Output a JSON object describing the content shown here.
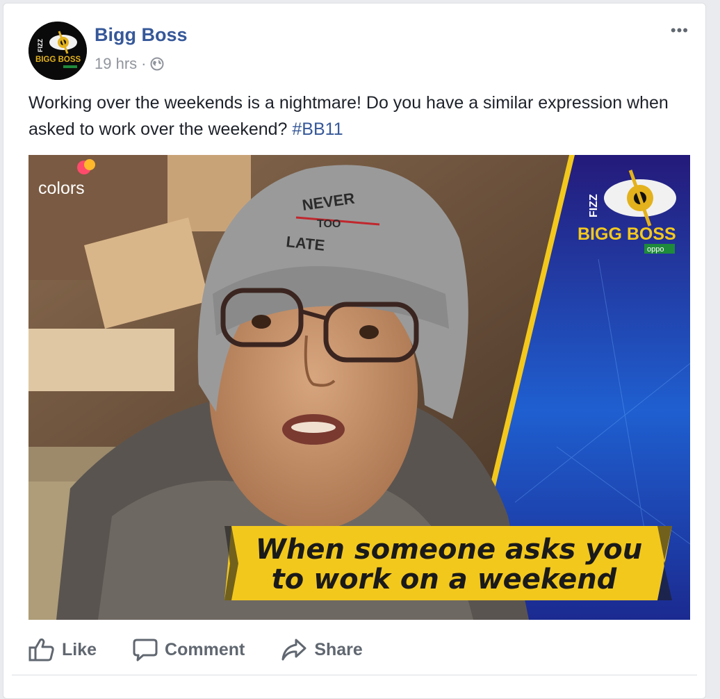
{
  "post": {
    "page_name": "Bigg Boss",
    "time": "19 hrs",
    "separator": "·",
    "audience_icon": "globe-icon",
    "more_icon": "more-options-icon",
    "text_main": "Working over the weekends is a nightmare! Do you have a similar expression when asked to work over the weekend?",
    "hashtag": "#BB11"
  },
  "avatar": {
    "brand_small": "FIZZ",
    "brand_name": "BIGG BOSS"
  },
  "media": {
    "channel_logo": "colors",
    "hat_text_1": "NEVER",
    "hat_text_2": "TOO",
    "hat_text_3": "LATE",
    "show_brand_small": "FIZZ",
    "show_name": "BIGG BOSS",
    "sponsor": "oppo",
    "caption_line1": "When someone asks you",
    "caption_line2": "to work on a weekend"
  },
  "actions": {
    "like": "Like",
    "comment": "Comment",
    "share": "Share"
  },
  "colors": {
    "link_blue": "#365899",
    "caption_yellow": "#f7d42a",
    "panel_blue": "#1a3a9c"
  }
}
